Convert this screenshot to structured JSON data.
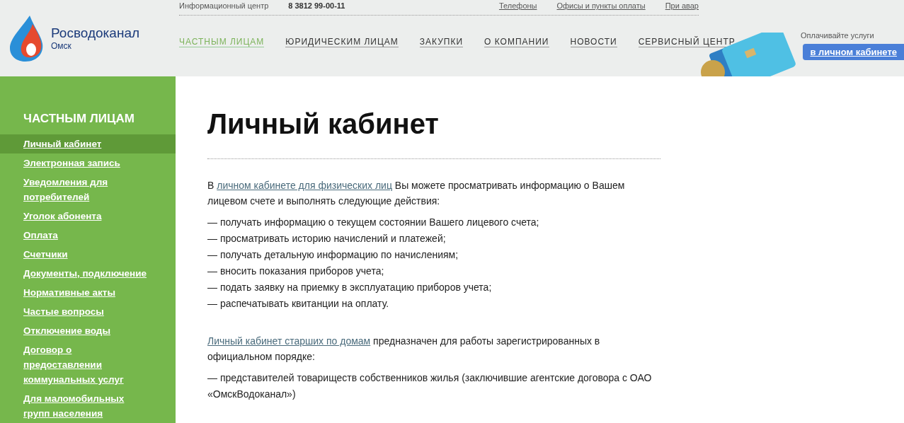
{
  "header": {
    "logo": {
      "name": "Росводоканал",
      "city": "Омск"
    },
    "top_links": [
      {
        "kind": "label",
        "text": "Информационный центр"
      },
      {
        "kind": "phone",
        "text": "8 3812 99-00-11"
      },
      {
        "kind": "link",
        "text": "Телефоны"
      },
      {
        "kind": "link",
        "text": "Офисы и пункты оплаты"
      },
      {
        "kind": "link",
        "text": "При авар"
      }
    ],
    "nav": [
      {
        "label": "ЧАСТНЫМ ЛИЦАМ",
        "selected": true
      },
      {
        "label": "ЮРИДИЧЕСКИМ ЛИЦАМ",
        "selected": false
      },
      {
        "label": "ЗАКУПКИ",
        "selected": false
      },
      {
        "label": "О КОМПАНИИ",
        "selected": false
      },
      {
        "label": "НОВОСТИ",
        "selected": false
      },
      {
        "label": "СЕРВИСНЫЙ ЦЕНТР",
        "selected": false
      }
    ],
    "payment": {
      "caption": "Оплачивайте услуги",
      "button": "в личном кабинете"
    }
  },
  "sidebar": {
    "title": "ЧАСТНЫМ ЛИЦАМ",
    "items": [
      {
        "label": "Личный кабинет",
        "selected": true
      },
      {
        "label": "Электронная запись",
        "selected": false
      },
      {
        "label": "Уведомления для потребителей",
        "selected": false
      },
      {
        "label": "Уголок абонента",
        "selected": false
      },
      {
        "label": "Оплата",
        "selected": false
      },
      {
        "label": "Счетчики",
        "selected": false
      },
      {
        "label": "Документы, подключение",
        "selected": false
      },
      {
        "label": "Нормативные акты",
        "selected": false
      },
      {
        "label": "Частые вопросы",
        "selected": false
      },
      {
        "label": "Отключение воды",
        "selected": false
      },
      {
        "label": "Договор о предоставлении коммунальных услуг",
        "selected": false
      },
      {
        "label": "Для маломобильных групп населения",
        "selected": false
      }
    ]
  },
  "content": {
    "title": "Личный кабинет",
    "blocks": [
      {
        "kind": "paragraph",
        "parts": [
          {
            "kind": "plain",
            "text": "В "
          },
          {
            "kind": "link",
            "text": "личном кабинете для физических лиц"
          },
          {
            "kind": "plain",
            "text": " Вы можете просматривать информацию о Вашем лицевом счете и выполнять следующие действия:"
          }
        ]
      },
      {
        "kind": "list",
        "items": [
          "— получать информацию о текущем состоянии Вашего лицевого счета;",
          "— просматривать историю начислений и платежей;",
          "— получать детальную информацию по начислениям;",
          "— вносить показания приборов учета;",
          "— подать заявку на приемку в эксплуатацию приборов учета;",
          "— распечатывать квитанции на оплату."
        ]
      },
      {
        "kind": "paragraph",
        "parts": [
          {
            "kind": "link",
            "text": "Личный кабинет старших по домам"
          },
          {
            "kind": "plain",
            "text": " предназначен для работы зарегистрированных в официальном порядке:"
          }
        ]
      },
      {
        "kind": "list",
        "items": [
          "— представителей товариществ собственников жилья (заключившие агентские договора с ОАО «ОмскВодоканал»)"
        ]
      }
    ]
  }
}
